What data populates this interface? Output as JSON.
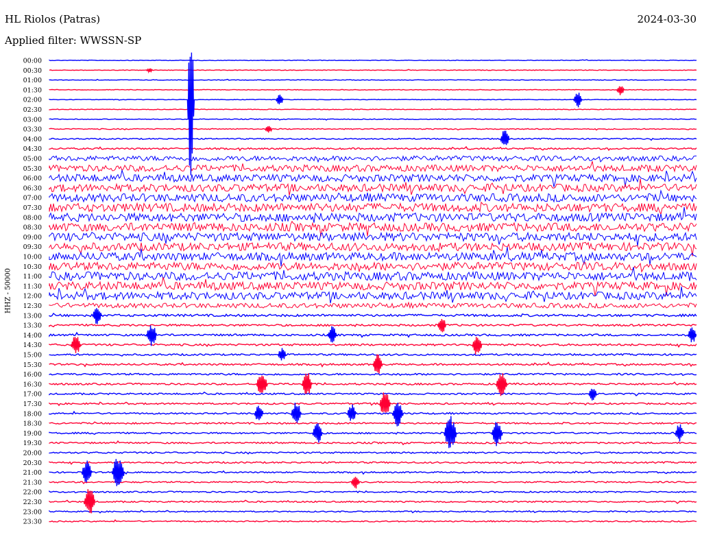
{
  "header": {
    "station": "HL Riolos (Patras)",
    "date": "2024-03-30",
    "filter": "Applied filter: WWSSN-SP"
  },
  "colors": {
    "trace_a": "#0000ff",
    "trace_b": "#ff0033",
    "text": "#000000",
    "background": "#ffffff"
  },
  "chart_data": {
    "type": "line",
    "ylabel": "HHZ - 50000",
    "rows": [
      "00:00",
      "00:30",
      "01:00",
      "01:30",
      "02:00",
      "02:30",
      "03:00",
      "03:30",
      "04:00",
      "04:30",
      "05:00",
      "05:30",
      "06:00",
      "06:30",
      "07:00",
      "07:30",
      "08:00",
      "08:30",
      "09:00",
      "09:30",
      "10:00",
      "10:30",
      "11:00",
      "11:30",
      "12:00",
      "12:30",
      "13:00",
      "13:30",
      "14:00",
      "14:30",
      "15:00",
      "15:30",
      "16:00",
      "16:30",
      "17:00",
      "17:30",
      "18:00",
      "18:30",
      "19:00",
      "19:30",
      "20:00",
      "20:30",
      "21:00",
      "21:30",
      "22:00",
      "22:30",
      "23:00",
      "23:30"
    ],
    "row_minutes": 30,
    "series_colors": [
      "#0000ff",
      "#ff0033"
    ],
    "noise_level_by_row": [
      0.3,
      0.3,
      0.3,
      0.3,
      0.3,
      0.3,
      0.4,
      0.5,
      0.6,
      0.8,
      2.6,
      3.4,
      3.8,
      4.0,
      4.2,
      4.4,
      4.4,
      4.4,
      4.4,
      4.2,
      4.2,
      4.2,
      4.4,
      4.2,
      4.0,
      2.5,
      1.2,
      1.0,
      1.0,
      1.0,
      0.9,
      0.9,
      0.9,
      0.9,
      0.8,
      0.8,
      0.8,
      0.8,
      0.8,
      0.8,
      0.8,
      0.8,
      0.7,
      0.7,
      0.7,
      0.7,
      0.6,
      0.6
    ],
    "events": [
      {
        "row": 1,
        "minute": 4.5,
        "amplitude": 3
      },
      {
        "row": 3,
        "minute": 26.3,
        "amplitude": 8
      },
      {
        "row": 4,
        "minute": 10.5,
        "amplitude": 8
      },
      {
        "row": 4,
        "minute": 24.3,
        "amplitude": 12
      },
      {
        "row": 7,
        "minute": 10.0,
        "amplitude": 6
      },
      {
        "row": 8,
        "minute": 20.9,
        "amplitude": 14
      },
      {
        "row": 4,
        "minute": 6.4,
        "amplitude": 120
      },
      {
        "row": 26,
        "minute": 2.0,
        "amplitude": 14
      },
      {
        "row": 27,
        "minute": 18.0,
        "amplitude": 12
      },
      {
        "row": 28,
        "minute": 4.5,
        "amplitude": 18
      },
      {
        "row": 28,
        "minute": 12.9,
        "amplitude": 14
      },
      {
        "row": 28,
        "minute": 29.6,
        "amplitude": 12
      },
      {
        "row": 29,
        "minute": 1.0,
        "amplitude": 16
      },
      {
        "row": 29,
        "minute": 19.6,
        "amplitude": 16
      },
      {
        "row": 30,
        "minute": 10.6,
        "amplitude": 10
      },
      {
        "row": 31,
        "minute": 15.0,
        "amplitude": 16
      },
      {
        "row": 33,
        "minute": 9.6,
        "amplitude": 20
      },
      {
        "row": 33,
        "minute": 11.7,
        "amplitude": 18
      },
      {
        "row": 33,
        "minute": 20.7,
        "amplitude": 22
      },
      {
        "row": 34,
        "minute": 25.0,
        "amplitude": 10
      },
      {
        "row": 35,
        "minute": 15.3,
        "amplitude": 22
      },
      {
        "row": 36,
        "minute": 9.5,
        "amplitude": 14
      },
      {
        "row": 36,
        "minute": 11.2,
        "amplitude": 18
      },
      {
        "row": 36,
        "minute": 13.8,
        "amplitude": 14
      },
      {
        "row": 36,
        "minute": 15.9,
        "amplitude": 20
      },
      {
        "row": 38,
        "minute": 12.2,
        "amplitude": 16
      },
      {
        "row": 38,
        "minute": 18.3,
        "amplitude": 26
      },
      {
        "row": 38,
        "minute": 20.5,
        "amplitude": 20
      },
      {
        "row": 38,
        "minute": 29.0,
        "amplitude": 14
      },
      {
        "row": 42,
        "minute": 1.5,
        "amplitude": 18
      },
      {
        "row": 42,
        "minute": 2.9,
        "amplitude": 26
      },
      {
        "row": 43,
        "minute": 14.0,
        "amplitude": 10
      },
      {
        "row": 45,
        "minute": 1.6,
        "amplitude": 22
      }
    ]
  }
}
